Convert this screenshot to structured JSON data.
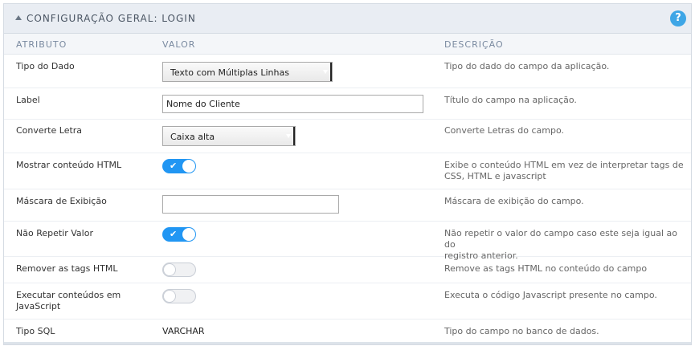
{
  "header": {
    "title": "CONFIGURAÇÃO GERAL: LOGIN",
    "help": "?"
  },
  "columns": {
    "attr": "ATRIBUTO",
    "value": "VALOR",
    "desc": "DESCRIÇÃO"
  },
  "rows": [
    {
      "attr": "Tipo do Dado",
      "type": "select",
      "value": "Texto com Múltiplas Linhas",
      "desc": "Tipo do dado do campo da aplicação."
    },
    {
      "attr": "Label",
      "type": "text",
      "value": "Nome do Cliente",
      "desc": "Título do campo na aplicação."
    },
    {
      "attr": "Converte Letra",
      "type": "select",
      "value": "Caixa alta",
      "desc": "Converte Letras do campo."
    },
    {
      "attr": "Mostrar conteúdo HTML",
      "type": "toggle",
      "on": true,
      "desc_line1": "Exibe o conteúdo HTML em vez de interpretar tags de",
      "desc_line2": "CSS, HTML e javascript"
    },
    {
      "attr": "Máscara de Exibição",
      "type": "text",
      "value": "",
      "desc": "Máscara de exibição do campo."
    },
    {
      "attr": "Não Repetir Valor",
      "type": "toggle",
      "on": true,
      "desc_line1": "Não repetir o valor do campo caso este seja igual ao do",
      "desc_line2": "registro anterior."
    },
    {
      "attr": "Remover as tags HTML",
      "type": "toggle",
      "on": false,
      "desc": "Remove as tags HTML no conteúdo do campo"
    },
    {
      "attr_line1": "Executar conteúdos em",
      "attr_line2": "JavaScript",
      "type": "toggle",
      "on": false,
      "desc": "Executa o código Javascript presente no campo."
    },
    {
      "attr": "Tipo SQL",
      "type": "plain",
      "value": "VARCHAR",
      "desc": "Tipo do campo no banco de dados."
    }
  ]
}
